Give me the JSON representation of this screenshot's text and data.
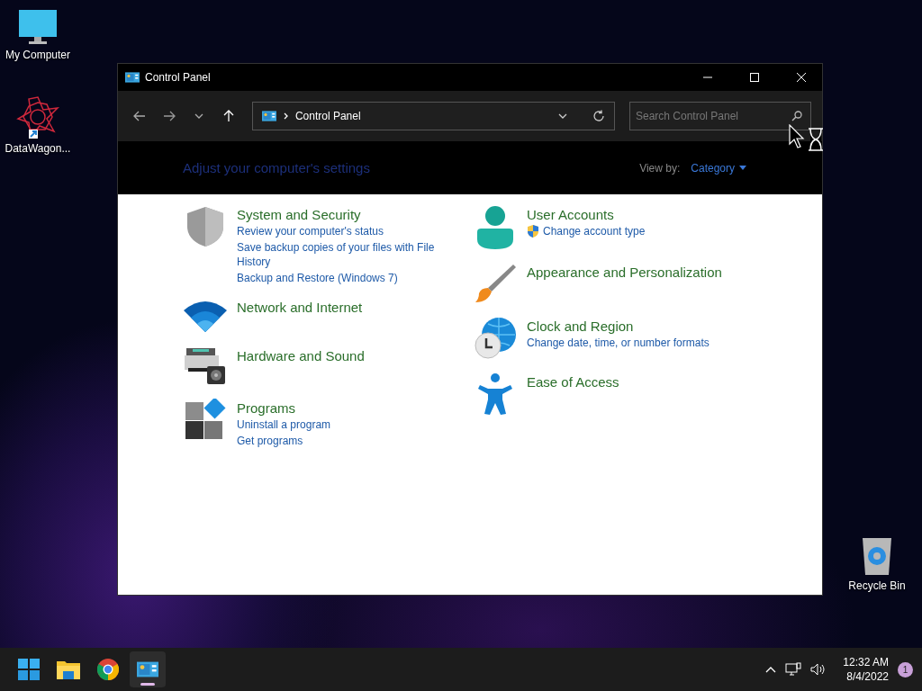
{
  "desktop_icons": [
    {
      "kind": "computer",
      "label": "My Computer"
    },
    {
      "kind": "app",
      "label": "DataWagon..."
    },
    {
      "kind": "recycle",
      "label": "Recycle Bin"
    }
  ],
  "window": {
    "title": "Control Panel",
    "address": {
      "path": "Control Panel"
    },
    "search": {
      "placeholder": "Search Control Panel"
    },
    "header": {
      "heading": "Adjust your computer's settings",
      "view_by_label": "View by:",
      "view_by_value": "Category"
    },
    "columns": [
      [
        {
          "kind": "security",
          "title": "System and Security",
          "links": [
            {
              "text": "Review your computer's status",
              "uac": false
            },
            {
              "text": "Save backup copies of your files with File History",
              "uac": false
            },
            {
              "text": "Backup and Restore (Windows 7)",
              "uac": false
            }
          ]
        },
        {
          "kind": "network",
          "title": "Network and Internet"
        },
        {
          "kind": "hardware",
          "title": "Hardware and Sound"
        },
        {
          "kind": "programs",
          "title": "Programs",
          "links": [
            {
              "text": "Uninstall a program",
              "uac": false
            },
            {
              "text": "Get programs",
              "uac": false
            }
          ]
        }
      ],
      [
        {
          "kind": "user",
          "title": "User Accounts",
          "links": [
            {
              "text": "Change account type",
              "uac": true
            }
          ]
        },
        {
          "kind": "appearance",
          "title": "Appearance and Personalization"
        },
        {
          "kind": "clock",
          "title": "Clock and Region",
          "links": [
            {
              "text": "Change date, time, or number formats",
              "uac": false
            }
          ]
        },
        {
          "kind": "access",
          "title": "Ease of Access"
        }
      ]
    ]
  },
  "taskbar": {
    "apps": [
      {
        "kind": "start",
        "selected": false
      },
      {
        "kind": "explorer",
        "selected": false
      },
      {
        "kind": "chrome",
        "selected": false
      },
      {
        "kind": "control",
        "selected": true
      }
    ],
    "time": "12:32 AM",
    "date": "8/4/2022",
    "notifications": "1"
  }
}
